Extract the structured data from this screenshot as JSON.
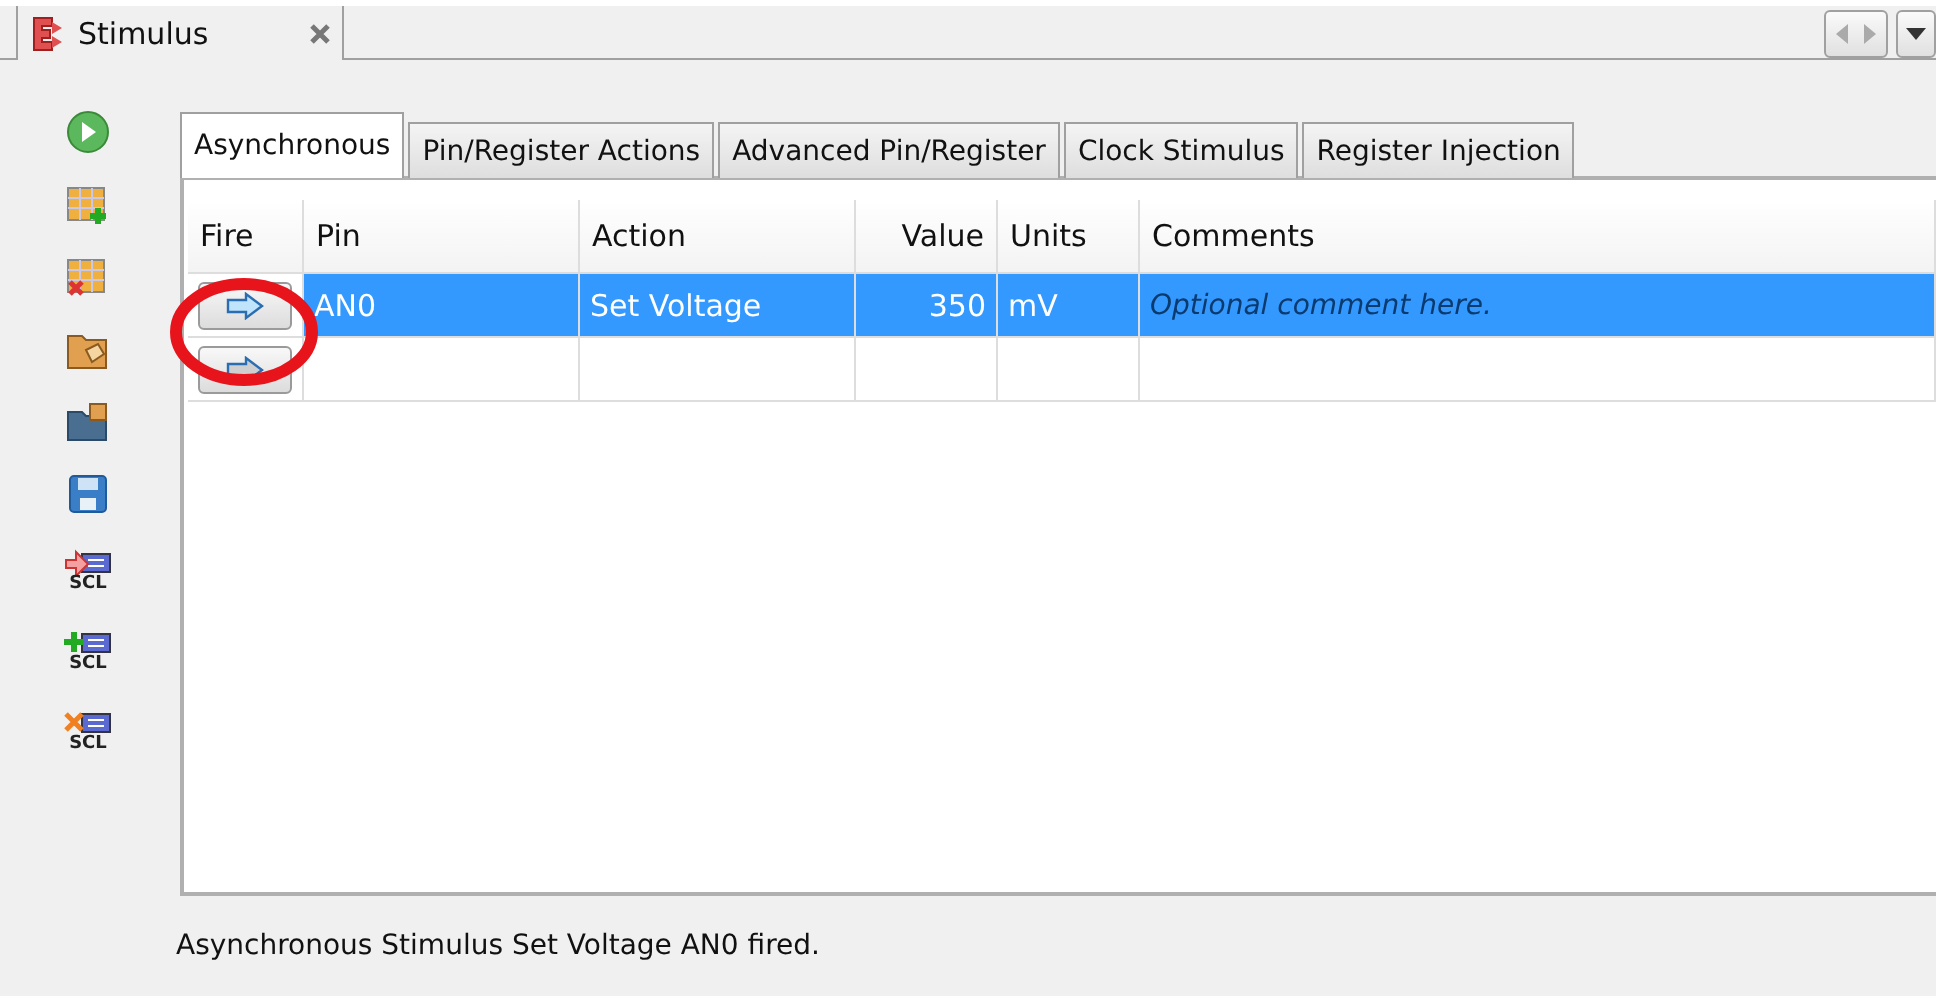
{
  "editor_tab": {
    "title": "Stimulus",
    "selected": true
  },
  "toolbar": [
    {
      "kind": "run"
    },
    {
      "kind": "add-row"
    },
    {
      "kind": "remove-row"
    },
    {
      "kind": "open"
    },
    {
      "kind": "folder"
    },
    {
      "kind": "save"
    },
    {
      "kind": "scl-apply",
      "label": "SCL"
    },
    {
      "kind": "scl-add",
      "label": "SCL"
    },
    {
      "kind": "scl-remove",
      "label": "SCL"
    }
  ],
  "tabs": [
    {
      "label": "Asynchronous",
      "selected": true
    },
    {
      "label": "Pin/Register Actions",
      "selected": false
    },
    {
      "label": "Advanced Pin/Register",
      "selected": false
    },
    {
      "label": "Clock Stimulus",
      "selected": false
    },
    {
      "label": "Register Injection",
      "selected": false
    }
  ],
  "table": {
    "columns": [
      "Fire",
      "Pin",
      "Action",
      "Value",
      "Units",
      "Comments"
    ],
    "rows": [
      {
        "selected": true,
        "pin": "AN0",
        "action": "Set Voltage",
        "value": "350",
        "units": "mV",
        "comment_placeholder": "Optional comment here."
      },
      {
        "selected": false
      }
    ]
  },
  "status_bar": "Asynchronous Stimulus Set Voltage AN0 fired."
}
